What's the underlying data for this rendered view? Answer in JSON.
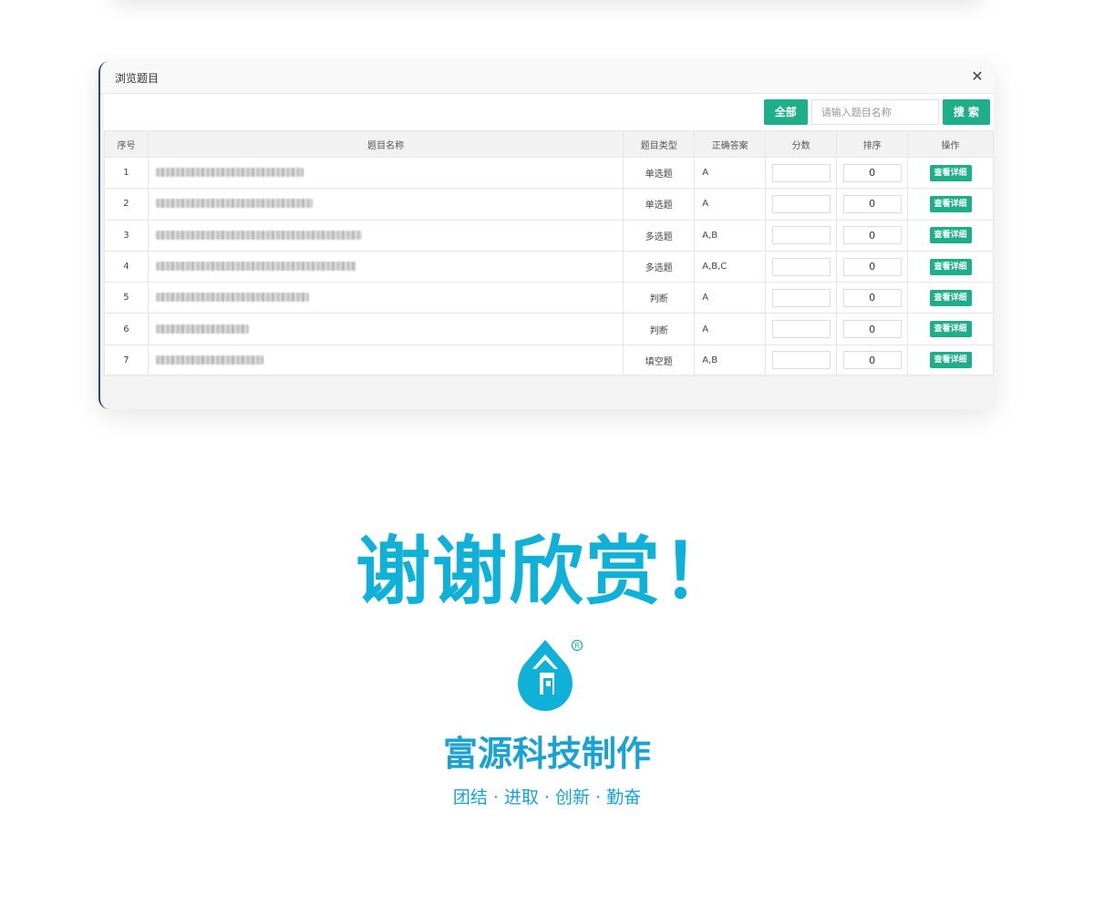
{
  "dialog": {
    "title": "浏览题目",
    "close_glyph": "✕"
  },
  "toolbar": {
    "all_label": "全部",
    "search_placeholder": "请输入题目名称",
    "search_label": "搜 索"
  },
  "table": {
    "headers": [
      "序号",
      "题目名称",
      "题目类型",
      "正确答案",
      "分数",
      "排序",
      "操作"
    ],
    "rows": [
      {
        "no": "1",
        "type": "单选题",
        "answer": "A",
        "score": "",
        "order": "0",
        "action": "查看详细"
      },
      {
        "no": "2",
        "type": "单选题",
        "answer": "A",
        "score": "",
        "order": "0",
        "action": "查看详细"
      },
      {
        "no": "3",
        "type": "多选题",
        "answer": "A,B",
        "score": "",
        "order": "0",
        "action": "查看详细"
      },
      {
        "no": "4",
        "type": "多选题",
        "answer": "A,B,C",
        "score": "",
        "order": "0",
        "action": "查看详细"
      },
      {
        "no": "5",
        "type": "判断",
        "answer": "A",
        "score": "",
        "order": "0",
        "action": "查看详细"
      },
      {
        "no": "6",
        "type": "判断",
        "answer": "A",
        "score": "",
        "order": "0",
        "action": "查看详细"
      },
      {
        "no": "7",
        "type": "填空题",
        "answer": "A,B",
        "score": "",
        "order": "0",
        "action": "查看详细"
      }
    ]
  },
  "footer": {
    "thanks": "谢谢欣赏！",
    "company": "富源科技制作",
    "slogan": "团结 · 进取 · 创新 · 勤奋",
    "logo_icon": "water-drop-house-icon",
    "brand_color": "#0fb1d8"
  }
}
